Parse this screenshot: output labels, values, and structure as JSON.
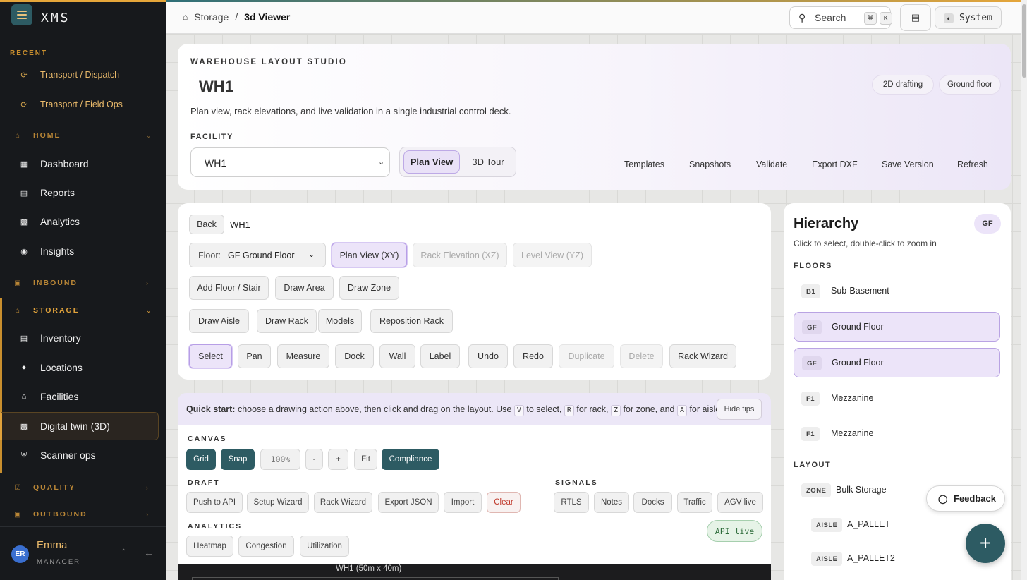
{
  "app": {
    "name": "XMS"
  },
  "sidebar": {
    "recent_label": "RECENT",
    "recent": [
      {
        "label": "Transport / Dispatch",
        "icon": "refresh-icon"
      },
      {
        "label": "Transport / Field Ops",
        "icon": "refresh-icon"
      }
    ],
    "home_label": "HOME",
    "home_items": [
      {
        "label": "Dashboard",
        "icon": "grid-icon"
      },
      {
        "label": "Reports",
        "icon": "document-icon"
      },
      {
        "label": "Analytics",
        "icon": "bar-chart-icon"
      },
      {
        "label": "Insights",
        "icon": "globe-icon"
      }
    ],
    "inbound_label": "INBOUND",
    "storage_label": "STORAGE",
    "storage_items": [
      {
        "label": "Inventory",
        "icon": "box-icon"
      },
      {
        "label": "Locations",
        "icon": "pin-icon"
      },
      {
        "label": "Facilities",
        "icon": "building-icon"
      },
      {
        "label": "Digital twin (3D)",
        "icon": "chart-icon",
        "active": true
      },
      {
        "label": "Scanner ops",
        "icon": "shield-icon"
      }
    ],
    "quality_label": "QUALITY",
    "outbound_label": "OUTBOUND",
    "user": {
      "initials": "ER",
      "name": "Emma",
      "role": "MANAGER"
    }
  },
  "topbar": {
    "breadcrumb": [
      "Storage",
      "3d Viewer"
    ],
    "search_label": "Search",
    "kbd": [
      "⌘",
      "K"
    ],
    "system_label": "System"
  },
  "hero": {
    "eyebrow": "WAREHOUSE LAYOUT STUDIO",
    "title": "WH1",
    "description": "Plan view, rack elevations, and live validation in a single industrial control deck.",
    "pills": [
      "2D drafting",
      "Ground floor"
    ],
    "facility_label": "FACILITY",
    "facility_value": "WH1",
    "view_modes": [
      "Plan View",
      "3D Tour"
    ],
    "actions": [
      "Templates",
      "Snapshots",
      "Validate",
      "Export DXF",
      "Save Version",
      "Refresh"
    ]
  },
  "tools": {
    "back_label": "Back",
    "context": "WH1",
    "floor_label": "Floor:",
    "floor_value": "GF Ground Floor",
    "views": [
      "Plan View (XY)",
      "Rack Elevation (XZ)",
      "Level View (YZ)"
    ],
    "row2": [
      "Add Floor / Stair",
      "Draw Area",
      "Draw Zone"
    ],
    "row3": [
      "Draw Aisle",
      "Draw Rack",
      "Models",
      "Reposition Rack"
    ],
    "row4": [
      "Select",
      "Pan",
      "Measure",
      "Dock",
      "Wall",
      "Label",
      "Undo",
      "Redo",
      "Duplicate",
      "Delete",
      "Rack Wizard"
    ]
  },
  "tips": {
    "lead": "Quick start:",
    "text1": " choose a drawing action above, then click and drag on the layout. Use ",
    "k1": "V",
    "t2": " to select, ",
    "k2": "R",
    "t3": " for rack, ",
    "k3": "Z",
    "t4": " for zone, and ",
    "k4": "A",
    "t5": " for aisle.",
    "hide_label": "Hide tips"
  },
  "controls": {
    "canvas_label": "CANVAS",
    "canvas": [
      "Grid",
      "Snap",
      "100%",
      "-",
      "+",
      "Fit",
      "Compliance"
    ],
    "draft_label": "DRAFT",
    "draft": [
      "Push to API",
      "Setup Wizard",
      "Rack Wizard",
      "Export JSON",
      "Import",
      "Clear"
    ],
    "signals_label": "SIGNALS",
    "signals": [
      "RTLS",
      "Notes",
      "Docks",
      "Traffic",
      "AGV live"
    ],
    "analytics_label": "ANALYTICS",
    "analytics": [
      "Heatmap",
      "Congestion",
      "Utilization"
    ],
    "api_status": "API live"
  },
  "canvas": {
    "caption": "WH1 (50m x 40m)"
  },
  "hierarchy": {
    "title": "Hierarchy",
    "badge": "GF",
    "subtitle": "Click to select, double-click to zoom in",
    "floors_label": "FLOORS",
    "floors": [
      {
        "tag": "B1",
        "name": "Sub-Basement"
      },
      {
        "tag": "GF",
        "name": "Ground Floor"
      },
      {
        "tag": "GF",
        "name": "Ground Floor"
      },
      {
        "tag": "F1",
        "name": "Mezzanine"
      },
      {
        "tag": "F1",
        "name": "Mezzanine"
      }
    ],
    "layout_label": "LAYOUT",
    "layout": [
      {
        "tag": "ZONE",
        "name": "Bulk Storage"
      },
      {
        "tag": "AISLE",
        "name": "A_PALLET"
      },
      {
        "tag": "AISLE",
        "name": "A_PALLET2"
      }
    ]
  },
  "feedback_label": "Feedback",
  "fab_label": "+",
  "colors": {
    "accent": "#e6a63a",
    "teal": "#2d5b63",
    "selected": "#ece4f9"
  }
}
